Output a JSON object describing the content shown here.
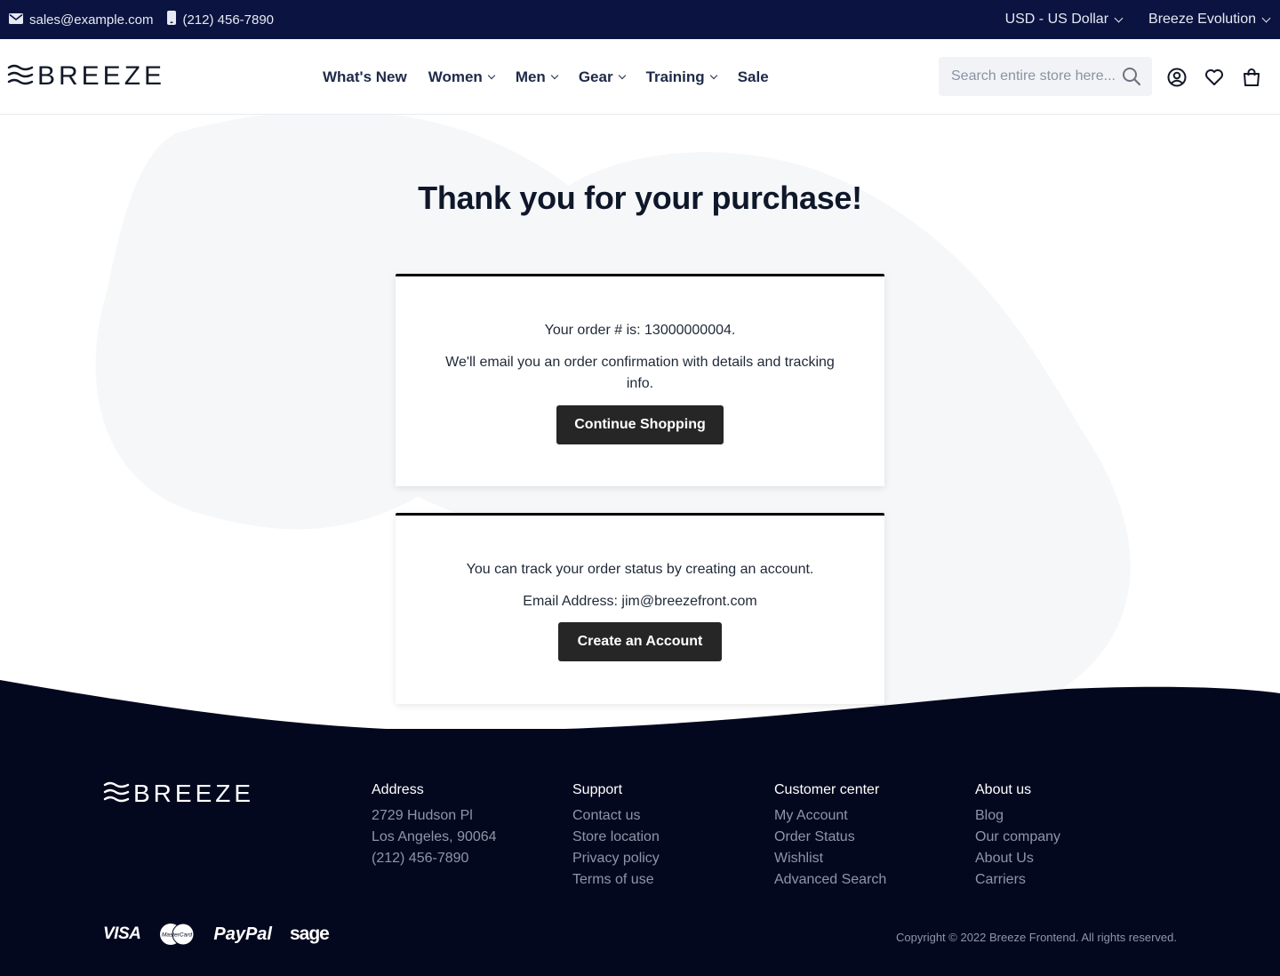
{
  "topbar": {
    "email": "sales@example.com",
    "phone": "(212) 456-7890",
    "currency": "USD - US Dollar",
    "store": "Breeze Evolution"
  },
  "header": {
    "logo": "BREEZE",
    "nav": [
      "What's New",
      "Women",
      "Men",
      "Gear",
      "Training",
      "Sale"
    ],
    "search_placeholder": "Search entire store here..."
  },
  "main": {
    "title": "Thank you for your purchase!",
    "order_line": "Your order # is: 13000000004.",
    "confirmation_text": "We'll email you an order confirmation with details and tracking info.",
    "continue_button": "Continue Shopping",
    "track_text": "You can track your order status by creating an account.",
    "email_line": "Email Address: jim@breezefront.com",
    "create_account_button": "Create an Account"
  },
  "footer": {
    "logo": "BREEZE",
    "address": {
      "heading": "Address",
      "lines": [
        "2729 Hudson Pl",
        "Los Angeles, 90064",
        "(212) 456-7890"
      ]
    },
    "support": {
      "heading": "Support",
      "links": [
        "Contact us",
        "Store location",
        "Privacy policy",
        "Terms of use"
      ]
    },
    "customer_center": {
      "heading": "Customer center",
      "links": [
        "My Account",
        "Order Status",
        "Wishlist",
        "Advanced Search"
      ]
    },
    "about": {
      "heading": "About us",
      "links": [
        "Blog",
        "Our company",
        "About Us",
        "Carriers"
      ]
    },
    "payments": [
      "VISA",
      "MasterCard",
      "PayPal",
      "sage"
    ],
    "copyright": "Copyright © 2022 Breeze Frontend. All rights reserved."
  },
  "colors": {
    "topbar_bg": "#0b1440",
    "footer_bg": "#04081f",
    "nav_text": "#1e2a4a",
    "button_bg": "#262626"
  }
}
